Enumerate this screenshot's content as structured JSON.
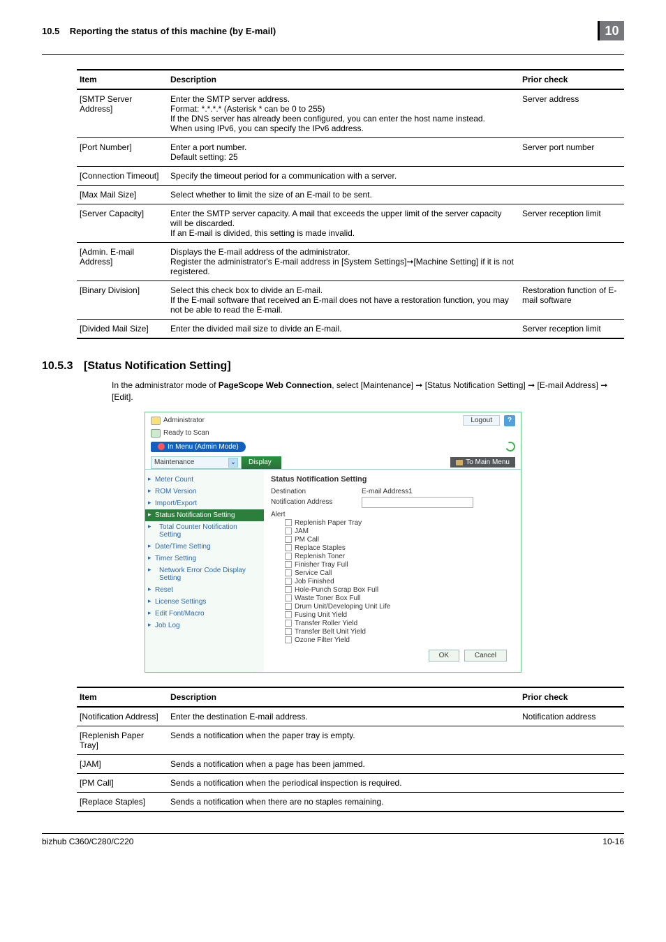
{
  "header": {
    "section": "10.5",
    "title": "Reporting the status of this machine (by E-mail)",
    "chapter": "10"
  },
  "table1": {
    "headers": {
      "item": "Item",
      "desc": "Description",
      "prior": "Prior check"
    },
    "rows": [
      {
        "item": "[SMTP Server Address]",
        "desc": "Enter the SMTP server address.\nFormat: *.*.*.* (Asterisk * can be 0 to 255)\nIf the DNS server has already been configured, you can enter the host name instead.\nWhen using IPv6, you can specify the IPv6 address.",
        "prior": "Server address"
      },
      {
        "item": "[Port Number]",
        "desc": "Enter a port number.\nDefault setting: 25",
        "prior": "Server port number"
      },
      {
        "item": "[Connection Timeout]",
        "desc": "Specify the timeout period for a communication with a server.",
        "prior": ""
      },
      {
        "item": "[Max Mail Size]",
        "desc": "Select whether to limit the size of an E-mail to be sent.",
        "prior": ""
      },
      {
        "item": "[Server Capacity]",
        "desc": "Enter the SMTP server capacity. A mail that exceeds the upper limit of the server capacity will be discarded.\nIf an E-mail is divided, this setting is made invalid.",
        "prior": "Server reception limit"
      },
      {
        "item": "[Admin. E-mail Address]",
        "desc": "Displays the E-mail address of the administrator.\nRegister the administrator's E-mail address in [System Settings]➞[Machine Setting] if it is not registered.",
        "prior": ""
      },
      {
        "item": "[Binary Division]",
        "desc": "Select this check box to divide an E-mail.\nIf the E-mail software that received an E-mail does not have a restoration function, you may not be able to read the E-mail.",
        "prior": "Restoration function of E-mail software"
      },
      {
        "item": "[Divided Mail Size]",
        "desc": "Enter the divided mail size to divide an E-mail.",
        "prior": "Server reception limit"
      }
    ]
  },
  "section": {
    "number": "10.5.3",
    "title": "[Status Notification Setting]",
    "body": "In the administrator mode of PageScope Web Connection, select [Maintenance] ➞ [Status Notification Setting] ➞ [E-mail Address] ➞ [Edit]."
  },
  "admin": {
    "role": "Administrator",
    "logout": "Logout",
    "help": "?",
    "ready": "Ready to Scan",
    "mode": "In Menu (Admin Mode)",
    "tab_dropdown": "Maintenance",
    "tab_display": "Display",
    "to_main": "To Main Menu",
    "side": [
      "Meter Count",
      "ROM Version",
      "Import/Export",
      "Status Notification Setting",
      "Total Counter Notification Setting",
      "Date/Time Setting",
      "Timer Setting",
      "Network Error Code Display Setting",
      "Reset",
      "License Settings",
      "Edit Font/Macro",
      "Job Log"
    ],
    "panel_title": "Status Notification Setting",
    "destination_label": "Destination",
    "email1_label": "E-mail Address1",
    "addr_label": "Notification Address",
    "alert_label": "Alert",
    "alerts": [
      "Replenish Paper Tray",
      "JAM",
      "PM Call",
      "Replace Staples",
      "Replenish Toner",
      "Finisher Tray Full",
      "Service Call",
      "Job Finished",
      "Hole-Punch Scrap Box Full",
      "Waste Toner Box Full",
      "Drum Unit/Developing Unit Life",
      "Fusing Unit Yield",
      "Transfer Roller Yield",
      "Transfer Belt Unit Yield",
      "Ozone Filter Yield"
    ],
    "ok": "OK",
    "cancel": "Cancel"
  },
  "table2": {
    "headers": {
      "item": "Item",
      "desc": "Description",
      "prior": "Prior check"
    },
    "rows": [
      {
        "item": "[Notification Address]",
        "desc": "Enter the destination E-mail address.",
        "prior": "Notification address"
      },
      {
        "item": "[Replenish Paper Tray]",
        "desc": "Sends a notification when the paper tray is empty.",
        "prior": ""
      },
      {
        "item": "[JAM]",
        "desc": "Sends a notification when a page has been jammed.",
        "prior": ""
      },
      {
        "item": "[PM Call]",
        "desc": "Sends a notification when the periodical inspection is required.",
        "prior": ""
      },
      {
        "item": "[Replace Staples]",
        "desc": "Sends a notification when there are no staples remaining.",
        "prior": ""
      }
    ]
  },
  "footer": {
    "left": "bizhub C360/C280/C220",
    "right": "10-16"
  }
}
